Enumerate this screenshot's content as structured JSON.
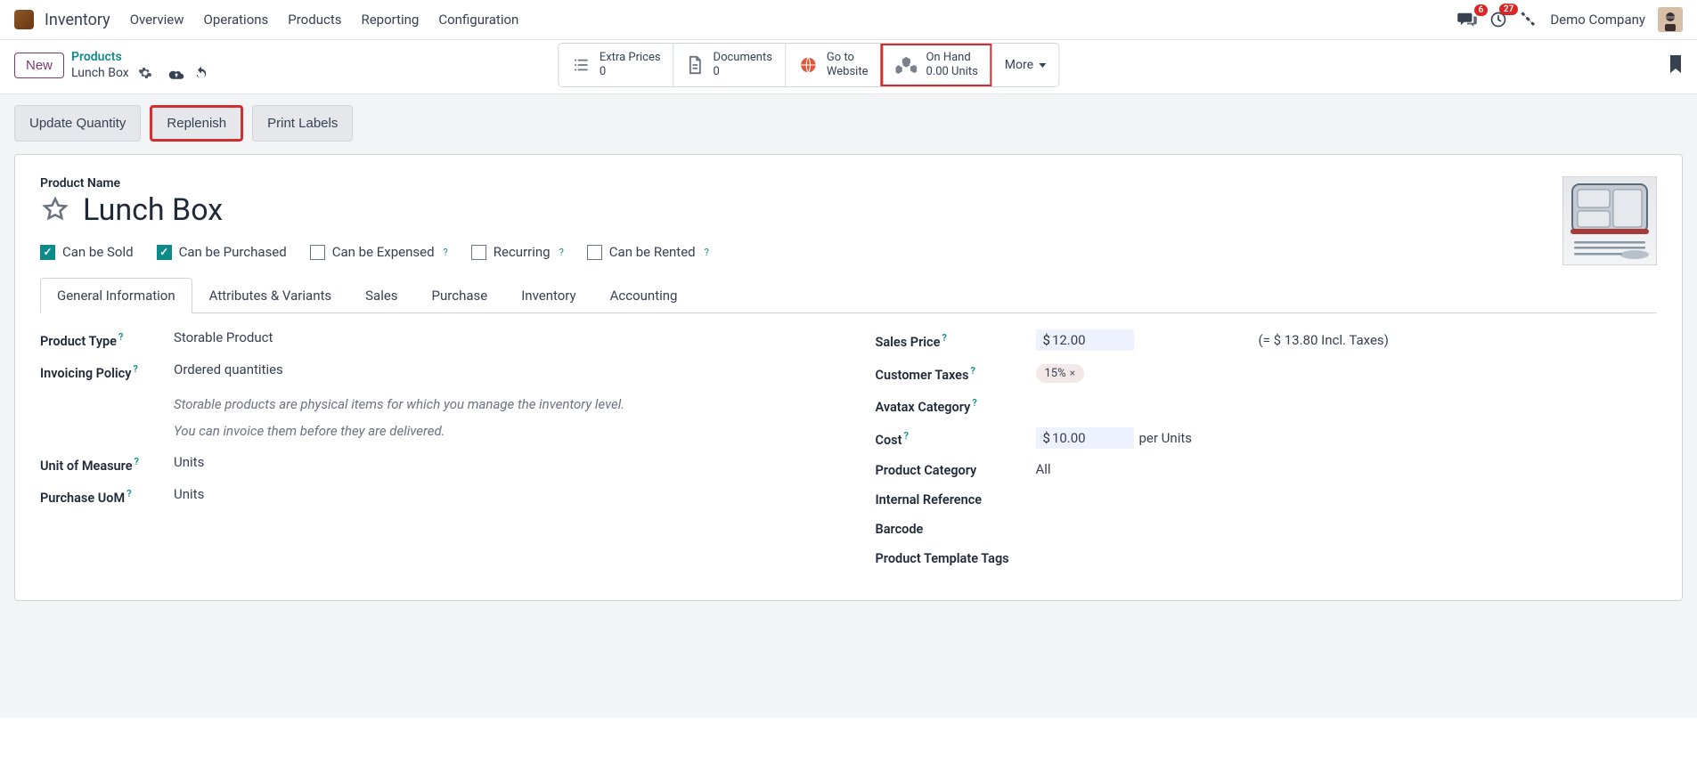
{
  "app": {
    "title": "Inventory"
  },
  "nav": [
    "Overview",
    "Operations",
    "Products",
    "Reporting",
    "Configuration"
  ],
  "topright": {
    "messages_badge": "6",
    "activities_badge": "27",
    "company": "Demo Company"
  },
  "toolbar": {
    "new_label": "New",
    "breadcrumb_top": "Products",
    "breadcrumb_current": "Lunch Box"
  },
  "stats": {
    "extra_prices": {
      "label": "Extra Prices",
      "value": "0"
    },
    "documents": {
      "label": "Documents",
      "value": "0"
    },
    "go_website": {
      "line1": "Go to",
      "line2": "Website"
    },
    "on_hand": {
      "label": "On Hand",
      "value": "0.00 Units"
    },
    "more": "More"
  },
  "actions": {
    "update_quantity": "Update Quantity",
    "replenish": "Replenish",
    "print_labels": "Print Labels"
  },
  "form": {
    "name_label": "Product Name",
    "name": "Lunch Box",
    "flags": {
      "sold": "Can be Sold",
      "purchased": "Can be Purchased",
      "expensed": "Can be Expensed",
      "recurring": "Recurring",
      "rented": "Can be Rented"
    },
    "tabs": [
      "General Information",
      "Attributes & Variants",
      "Sales",
      "Purchase",
      "Inventory",
      "Accounting"
    ],
    "left": {
      "product_type_label": "Product Type",
      "product_type": "Storable Product",
      "invoicing_policy_label": "Invoicing Policy",
      "invoicing_policy": "Ordered quantities",
      "help1": "Storable products are physical items for which you manage the inventory level.",
      "help2": "You can invoice them before they are delivered.",
      "uom_label": "Unit of Measure",
      "uom": "Units",
      "purchase_uom_label": "Purchase UoM",
      "purchase_uom": "Units"
    },
    "right": {
      "sales_price_label": "Sales Price",
      "sales_price": "12.00",
      "incl_taxes": "(= $ 13.80 Incl. Taxes)",
      "customer_taxes_label": "Customer Taxes",
      "customer_taxes": "15%",
      "avatax_label": "Avatax Category",
      "cost_label": "Cost",
      "cost": "10.00",
      "cost_unit": "per Units",
      "product_category_label": "Product Category",
      "product_category": "All",
      "internal_ref_label": "Internal Reference",
      "barcode_label": "Barcode",
      "template_tags_label": "Product Template Tags"
    }
  }
}
